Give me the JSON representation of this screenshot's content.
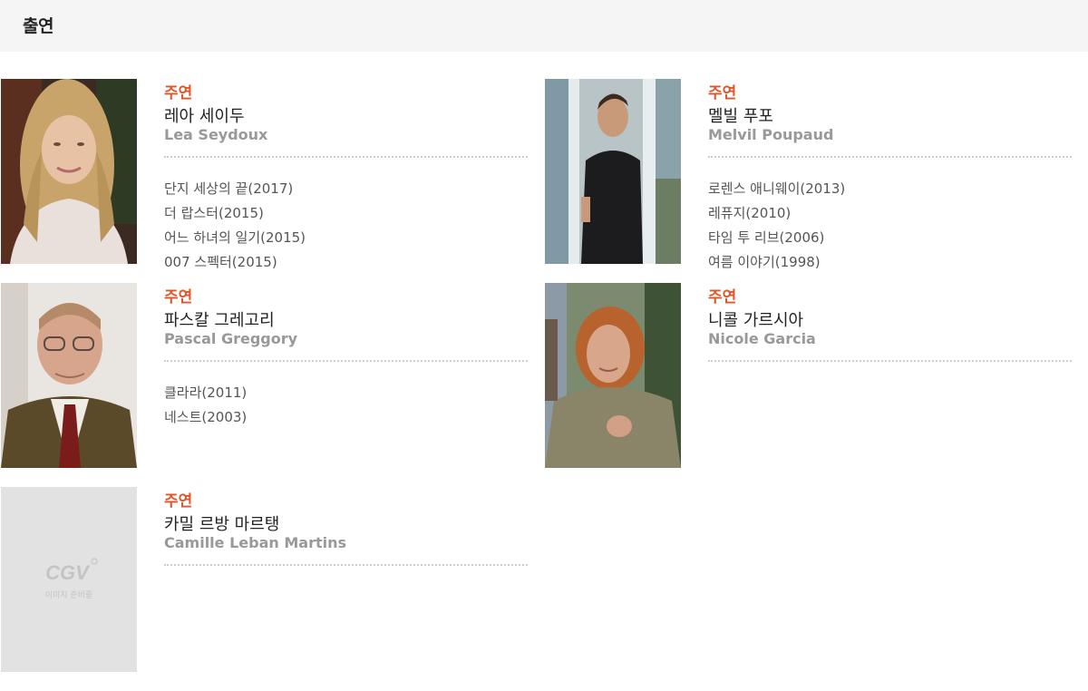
{
  "section": {
    "title": "출연"
  },
  "cast": [
    {
      "role": "주연",
      "name_ko": "레아 세이두",
      "name_en": "Lea Seydoux",
      "films": [
        "단지 세상의 끝(2017)",
        "더 랍스터(2015)",
        "어느 하녀의 일기(2015)",
        "007 스펙터(2015)"
      ]
    },
    {
      "role": "주연",
      "name_ko": "멜빌 푸포",
      "name_en": "Melvil Poupaud",
      "films": [
        "로렌스 애니웨이(2013)",
        "레퓨지(2010)",
        "타임 투 리브(2006)",
        "여름 이야기(1998)"
      ]
    },
    {
      "role": "주연",
      "name_ko": "파스칼 그레고리",
      "name_en": "Pascal Greggory",
      "films": [
        "클라라(2011)",
        "네스트(2003)"
      ]
    },
    {
      "role": "주연",
      "name_ko": "니콜 가르시아",
      "name_en": "Nicole Garcia",
      "films": []
    },
    {
      "role": "주연",
      "name_ko": "카밀 르방 마르탱",
      "name_en": "Camille Leban Martins",
      "films": [],
      "placeholder": {
        "logo": "CGV",
        "caption": "이미지 준비중"
      }
    }
  ],
  "colors": {
    "role_accent": "#e0562a",
    "header_bg": "#f5f5f5",
    "placeholder_bg": "#e2e2e2"
  }
}
